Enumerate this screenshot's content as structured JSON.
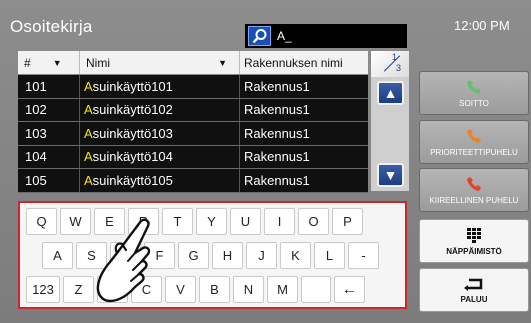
{
  "header": {
    "title": "Osoitekirja",
    "time": "12:00 PM",
    "search_value": "A_"
  },
  "table": {
    "columns": [
      "#",
      "Nimi",
      "Rakennuksen nimi"
    ],
    "rows": [
      {
        "num": "101",
        "name_prefix": "A",
        "name_rest": "suinkäyttö101",
        "building": "Rakennus1"
      },
      {
        "num": "102",
        "name_prefix": "A",
        "name_rest": "suinkäyttö102",
        "building": "Rakennus1"
      },
      {
        "num": "103",
        "name_prefix": "A",
        "name_rest": "suinkäyttö103",
        "building": "Rakennus1"
      },
      {
        "num": "104",
        "name_prefix": "A",
        "name_rest": "suinkäyttö104",
        "building": "Rakennus1"
      },
      {
        "num": "105",
        "name_prefix": "A",
        "name_rest": "suinkäyttö105",
        "building": "Rakennus1"
      }
    ]
  },
  "pagination": {
    "current": "1",
    "total": "3"
  },
  "keyboard": {
    "row1": [
      "Q",
      "W",
      "E",
      "R",
      "T",
      "Y",
      "U",
      "I",
      "O",
      "P"
    ],
    "row2": [
      "A",
      "S",
      "D",
      "F",
      "G",
      "H",
      "J",
      "K",
      "L",
      "-"
    ],
    "row3": [
      "123",
      "Z",
      "X",
      "C",
      "V",
      "B",
      "N",
      "M",
      "",
      "←"
    ]
  },
  "side_buttons": {
    "call": "SOITTO",
    "priority_call": "PRIORITEETTIPUHELU",
    "emergency_call": "KIIREELLINEN PUHELU",
    "keypad": "NÄPPÄIMISTÖ",
    "back": "PALUU"
  },
  "colors": {
    "highlight": "#f5e31a",
    "keyboard_border": "#c8282a",
    "scroll_button": "#1d3d82",
    "call_icon": "#5fc26a",
    "priority_icon": "#e8852a",
    "emergency_icon": "#e0452a"
  }
}
